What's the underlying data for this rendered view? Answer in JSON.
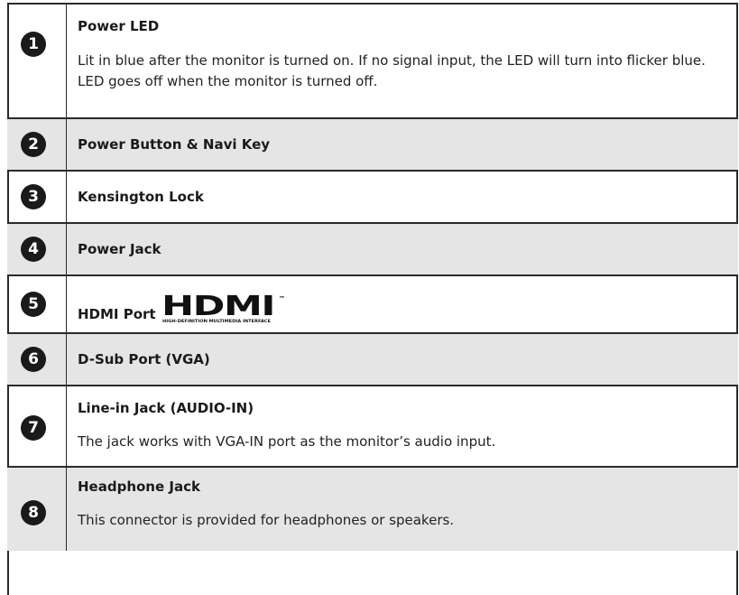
{
  "items": [
    {
      "number": "1",
      "title": "Power LED",
      "description": "Lit in blue after the monitor is turned on. If no signal input, the LED will turn into flicker blue. LED goes off when the monitor is turned off."
    },
    {
      "number": "2",
      "title": "Power Button & Navi Key"
    },
    {
      "number": "3",
      "title": "Kensington Lock"
    },
    {
      "number": "4",
      "title": "Power Jack"
    },
    {
      "number": "5",
      "title": "HDMI Port",
      "logo_text": "HDMI",
      "logo_tagline": "HIGH-DEFINITION MULTIMEDIA INTERFACE",
      "logo_tm": "™"
    },
    {
      "number": "6",
      "title": "D-Sub Port (VGA)"
    },
    {
      "number": "7",
      "title": "Line-in Jack (AUDIO-IN)",
      "description": "The jack works with VGA-IN port as the monitor’s audio input."
    },
    {
      "number": "8",
      "title": "Headphone Jack",
      "description": "This connector is provided for headphones or speakers."
    }
  ]
}
